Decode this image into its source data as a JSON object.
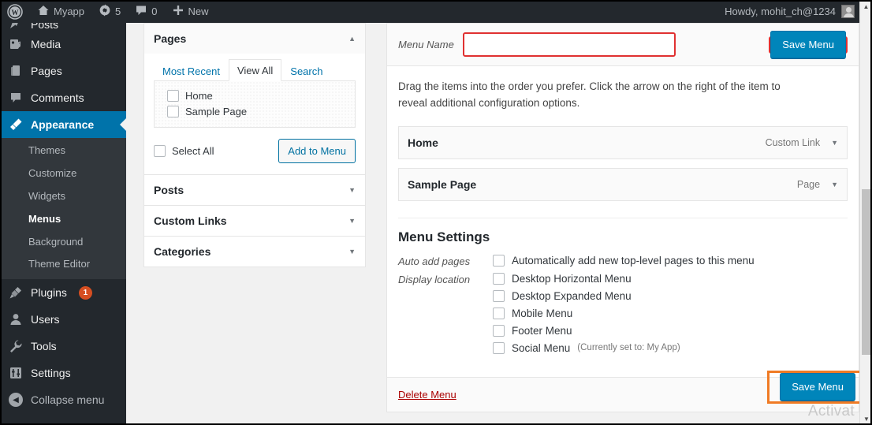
{
  "adminbar": {
    "site_name": "Myapp",
    "updates_count": "5",
    "comments_count": "0",
    "new_label": "New",
    "howdy": "Howdy, mohit_ch@1234"
  },
  "sidebar": {
    "items": [
      {
        "label": "Posts",
        "icon": "pin-icon",
        "clipped": true
      },
      {
        "label": "Media",
        "icon": "media-icon"
      },
      {
        "label": "Pages",
        "icon": "pages-icon"
      },
      {
        "label": "Comments",
        "icon": "comments-icon"
      },
      {
        "label": "Appearance",
        "icon": "brush-icon",
        "current": true
      },
      {
        "label": "Plugins",
        "icon": "plug-icon",
        "badge": "1"
      },
      {
        "label": "Users",
        "icon": "user-icon"
      },
      {
        "label": "Tools",
        "icon": "wrench-icon"
      },
      {
        "label": "Settings",
        "icon": "settings-icon"
      }
    ],
    "appearance_submenu": [
      {
        "label": "Themes"
      },
      {
        "label": "Customize"
      },
      {
        "label": "Widgets"
      },
      {
        "label": "Menus",
        "active": true
      },
      {
        "label": "Background"
      },
      {
        "label": "Theme Editor"
      }
    ],
    "collapse_label": "Collapse menu"
  },
  "accordion": {
    "pages": {
      "title": "Pages",
      "expanded": true,
      "tabs": [
        {
          "label": "Most Recent",
          "active": false
        },
        {
          "label": "View All",
          "active": true
        },
        {
          "label": "Search",
          "active": false
        }
      ],
      "items": [
        {
          "label": "Home",
          "checked": false
        },
        {
          "label": "Sample Page",
          "checked": false
        }
      ],
      "select_all_label": "Select All",
      "add_button_label": "Add to Menu"
    },
    "collapsed_panels": [
      {
        "title": "Posts"
      },
      {
        "title": "Custom Links"
      },
      {
        "title": "Categories"
      }
    ]
  },
  "menu_editor": {
    "menu_name_label": "Menu Name",
    "menu_name_value": "",
    "menu_name_placeholder": "",
    "save_top_label": "Save Menu",
    "helper_text": "Drag the items into the order you prefer. Click the arrow on the right of the item to reveal additional configuration options.",
    "rows": [
      {
        "title": "Home",
        "type": "Custom Link"
      },
      {
        "title": "Sample Page",
        "type": "Page"
      }
    ],
    "settings": {
      "title": "Menu Settings",
      "auto_add_label": "Auto add pages",
      "auto_add_option": "Automatically add new top-level pages to this menu",
      "display_location_label": "Display location",
      "locations": [
        {
          "label": "Desktop Horizontal Menu",
          "note": ""
        },
        {
          "label": "Desktop Expanded Menu",
          "note": ""
        },
        {
          "label": "Mobile Menu",
          "note": ""
        },
        {
          "label": "Footer Menu",
          "note": ""
        },
        {
          "label": "Social Menu",
          "note": "(Currently set to: My App)"
        }
      ]
    },
    "delete_label": "Delete Menu",
    "save_bottom_label": "Save Menu"
  },
  "watermark_text": "Activat",
  "colors": {
    "admin_bar": "#23282d",
    "sidebar": "#23282d",
    "submenu": "#32373c",
    "accent_blue": "#0073aa",
    "button_blue": "#0085ba",
    "badge_orange": "#d54e21",
    "highlight_red": "#e03131",
    "highlight_orange": "#f07b25",
    "delete_red": "#a00"
  }
}
